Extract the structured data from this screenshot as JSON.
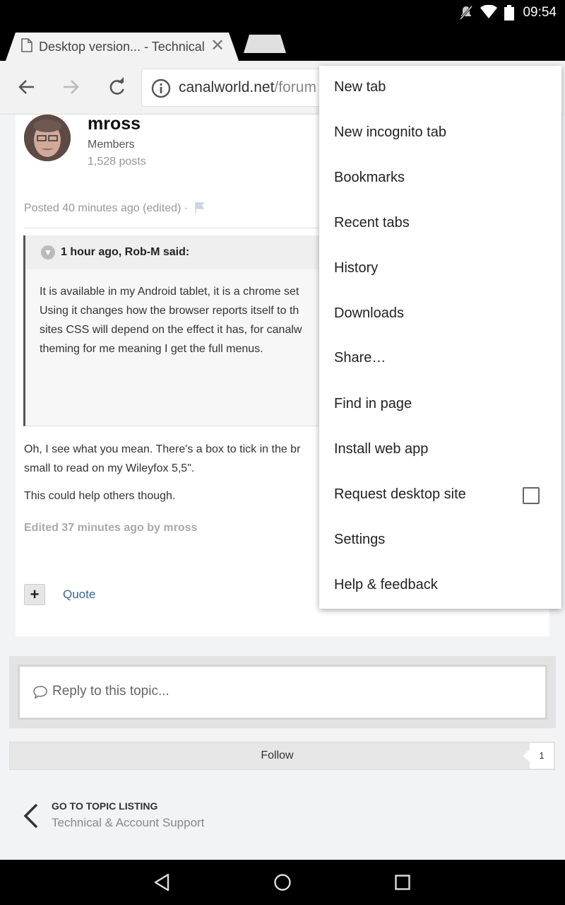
{
  "status_bar": {
    "time": "09:54"
  },
  "tab": {
    "title": "Desktop version... - Technical",
    "close_glyph": "✕"
  },
  "toolbar": {
    "url_host": "canalworld.net",
    "url_path": "/forum"
  },
  "post": {
    "author": "mross",
    "group": "Members",
    "posts": "1,528 posts",
    "posted": "Posted 40 minutes ago (edited) ·",
    "quote_header": "1 hour ago, Rob-M said:",
    "quote_body": "It is available in my Android tablet, it is a chrome set\nUsing it changes how the browser reports itself to th\nsites CSS will depend on the effect it has, for canalw\ntheming for me meaning I get the full menus.",
    "reply_body": "Oh, I see what you mean.  There's a box to tick in the br\nsmall to read on my Wileyfox 5,5\".",
    "reply_body_2": "This could help others though.",
    "edited": "Edited 37 minutes ago by mross",
    "plus": "+",
    "quote_link": "Quote"
  },
  "reply": {
    "placeholder": "Reply to this topic..."
  },
  "follow": {
    "label": "Follow",
    "count": "1"
  },
  "go_topic": {
    "heading": "GO TO TOPIC LISTING",
    "forum": "Technical & Account Support"
  },
  "menu": {
    "items": [
      {
        "label": "New tab"
      },
      {
        "label": "New incognito tab"
      },
      {
        "label": "Bookmarks"
      },
      {
        "label": "Recent tabs"
      },
      {
        "label": "History"
      },
      {
        "label": "Downloads"
      },
      {
        "label": "Share…"
      },
      {
        "label": "Find in page"
      },
      {
        "label": "Install web app"
      },
      {
        "label": "Request desktop site",
        "checked": false
      },
      {
        "label": "Settings"
      },
      {
        "label": "Help & feedback"
      }
    ]
  },
  "colors": {
    "link": "#3d6594",
    "status_bar": "#000000",
    "toolbar": "#f2f2f2"
  }
}
